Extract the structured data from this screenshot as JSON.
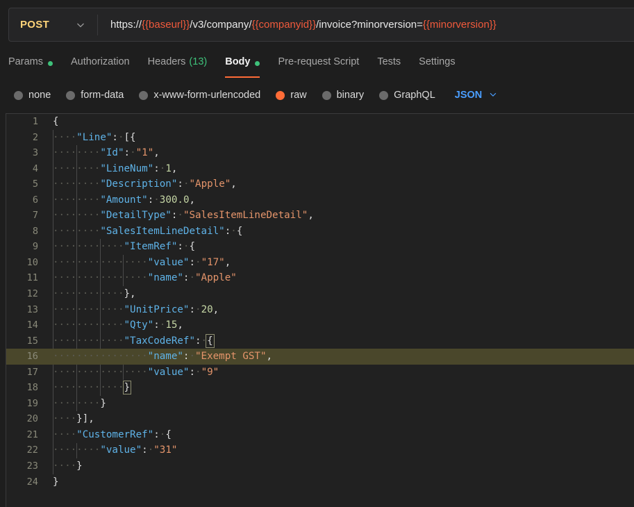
{
  "request": {
    "method": "POST",
    "method_icon": "chevron-down-icon",
    "url_parts": [
      {
        "t": "https://",
        "var": false
      },
      {
        "t": "{{baseurl}}",
        "var": true
      },
      {
        "t": "/v3/company/",
        "var": false
      },
      {
        "t": "{{companyid}}",
        "var": true
      },
      {
        "t": "/invoice?minorversion=",
        "var": false
      },
      {
        "t": "{{minorversion}}",
        "var": true
      }
    ],
    "url_plain": "https://{{baseurl}}/v3/company/{{companyid}}/invoice?minorversion={{minorversion}}"
  },
  "tabs": [
    {
      "label": "Params",
      "dot": true,
      "count": "",
      "active": false
    },
    {
      "label": "Authorization",
      "dot": false,
      "count": "",
      "active": false
    },
    {
      "label": "Headers",
      "dot": false,
      "count": "(13)",
      "active": false
    },
    {
      "label": "Body",
      "dot": true,
      "count": "",
      "active": true
    },
    {
      "label": "Pre-request Script",
      "dot": false,
      "count": "",
      "active": false
    },
    {
      "label": "Tests",
      "dot": false,
      "count": "",
      "active": false
    },
    {
      "label": "Settings",
      "dot": false,
      "count": "",
      "active": false
    }
  ],
  "body_types": [
    {
      "label": "none",
      "selected": false
    },
    {
      "label": "form-data",
      "selected": false
    },
    {
      "label": "x-www-form-urlencoded",
      "selected": false
    },
    {
      "label": "raw",
      "selected": true
    },
    {
      "label": "binary",
      "selected": false
    },
    {
      "label": "GraphQL",
      "selected": false
    }
  ],
  "format": {
    "label": "JSON",
    "icon": "chevron-down-icon"
  },
  "colors": {
    "accent": "#ff6c37",
    "method": "#ffd479",
    "variable": "#f05a3c",
    "dot": "#3ec17a",
    "format": "#4a9eff",
    "key": "#5fb3e8",
    "string": "#e5956b",
    "number": "#c5d6a5",
    "highlight_line": "#4a472b"
  },
  "editor": {
    "language": "json",
    "total_lines": 24,
    "active_line": 16,
    "raw_body": "{\n    \"Line\": [{\n        \"Id\": \"1\",\n        \"LineNum\": 1,\n        \"Description\": \"Apple\",\n        \"Amount\": 300.0,\n        \"DetailType\": \"SalesItemLineDetail\",\n        \"SalesItemLineDetail\": {\n            \"ItemRef\": {\n                \"value\": \"17\",\n                \"name\": \"Apple\"\n            },\n            \"UnitPrice\": 20,\n            \"Qty\": 15,\n            \"TaxCodeRef\": {\n                \"name\": \"Exempt GST\",\n                \"value\": \"9\"\n            }\n        }\n    }],\n    \"CustomerRef\": {\n        \"value\": \"31\"\n    }\n}",
    "lines": [
      {
        "no": 1,
        "indent": 0,
        "tokens": [
          {
            "c": "p",
            "t": "{"
          }
        ]
      },
      {
        "no": 2,
        "indent": 1,
        "tokens": [
          {
            "c": "k",
            "t": "\"Line\""
          },
          {
            "c": "p",
            "t": ":"
          },
          {
            "c": "ws",
            "t": "·"
          },
          {
            "c": "p",
            "t": "[{"
          }
        ]
      },
      {
        "no": 3,
        "indent": 2,
        "tokens": [
          {
            "c": "k",
            "t": "\"Id\""
          },
          {
            "c": "p",
            "t": ":"
          },
          {
            "c": "ws",
            "t": "·"
          },
          {
            "c": "s",
            "t": "\"1\""
          },
          {
            "c": "p",
            "t": ","
          }
        ]
      },
      {
        "no": 4,
        "indent": 2,
        "tokens": [
          {
            "c": "k",
            "t": "\"LineNum\""
          },
          {
            "c": "p",
            "t": ":"
          },
          {
            "c": "ws",
            "t": "·"
          },
          {
            "c": "n",
            "t": "1"
          },
          {
            "c": "p",
            "t": ","
          }
        ]
      },
      {
        "no": 5,
        "indent": 2,
        "tokens": [
          {
            "c": "k",
            "t": "\"Description\""
          },
          {
            "c": "p",
            "t": ":"
          },
          {
            "c": "ws",
            "t": "·"
          },
          {
            "c": "s",
            "t": "\"Apple\""
          },
          {
            "c": "p",
            "t": ","
          }
        ]
      },
      {
        "no": 6,
        "indent": 2,
        "tokens": [
          {
            "c": "k",
            "t": "\"Amount\""
          },
          {
            "c": "p",
            "t": ":"
          },
          {
            "c": "ws",
            "t": "·"
          },
          {
            "c": "n",
            "t": "300.0"
          },
          {
            "c": "p",
            "t": ","
          }
        ]
      },
      {
        "no": 7,
        "indent": 2,
        "tokens": [
          {
            "c": "k",
            "t": "\"DetailType\""
          },
          {
            "c": "p",
            "t": ":"
          },
          {
            "c": "ws",
            "t": "·"
          },
          {
            "c": "s",
            "t": "\"SalesItemLineDetail\""
          },
          {
            "c": "p",
            "t": ","
          }
        ]
      },
      {
        "no": 8,
        "indent": 2,
        "tokens": [
          {
            "c": "k",
            "t": "\"SalesItemLineDetail\""
          },
          {
            "c": "p",
            "t": ":"
          },
          {
            "c": "ws",
            "t": "·"
          },
          {
            "c": "p",
            "t": "{"
          }
        ]
      },
      {
        "no": 9,
        "indent": 3,
        "tokens": [
          {
            "c": "k",
            "t": "\"ItemRef\""
          },
          {
            "c": "p",
            "t": ":"
          },
          {
            "c": "ws",
            "t": "·"
          },
          {
            "c": "p",
            "t": "{"
          }
        ]
      },
      {
        "no": 10,
        "indent": 4,
        "tokens": [
          {
            "c": "k",
            "t": "\"value\""
          },
          {
            "c": "p",
            "t": ":"
          },
          {
            "c": "ws",
            "t": "·"
          },
          {
            "c": "s",
            "t": "\"17\""
          },
          {
            "c": "p",
            "t": ","
          }
        ]
      },
      {
        "no": 11,
        "indent": 4,
        "tokens": [
          {
            "c": "k",
            "t": "\"name\""
          },
          {
            "c": "p",
            "t": ":"
          },
          {
            "c": "ws",
            "t": "·"
          },
          {
            "c": "s",
            "t": "\"Apple\""
          }
        ]
      },
      {
        "no": 12,
        "indent": 3,
        "tokens": [
          {
            "c": "p",
            "t": "},"
          }
        ]
      },
      {
        "no": 13,
        "indent": 3,
        "tokens": [
          {
            "c": "k",
            "t": "\"UnitPrice\""
          },
          {
            "c": "p",
            "t": ":"
          },
          {
            "c": "ws",
            "t": "·"
          },
          {
            "c": "n",
            "t": "20"
          },
          {
            "c": "p",
            "t": ","
          }
        ]
      },
      {
        "no": 14,
        "indent": 3,
        "tokens": [
          {
            "c": "k",
            "t": "\"Qty\""
          },
          {
            "c": "p",
            "t": ":"
          },
          {
            "c": "ws",
            "t": "·"
          },
          {
            "c": "n",
            "t": "15"
          },
          {
            "c": "p",
            "t": ","
          }
        ]
      },
      {
        "no": 15,
        "indent": 3,
        "tokens": [
          {
            "c": "k",
            "t": "\"TaxCodeRef\""
          },
          {
            "c": "p",
            "t": ":"
          },
          {
            "c": "ws",
            "t": "·"
          },
          {
            "c": "p bm",
            "t": "{"
          }
        ]
      },
      {
        "no": 16,
        "indent": 4,
        "hl": true,
        "tokens": [
          {
            "c": "k",
            "t": "\"name\""
          },
          {
            "c": "p",
            "t": ":"
          },
          {
            "c": "ws",
            "t": "·"
          },
          {
            "c": "s",
            "t": "\"Exempt GST\""
          },
          {
            "c": "p",
            "t": ","
          }
        ]
      },
      {
        "no": 17,
        "indent": 4,
        "tokens": [
          {
            "c": "k",
            "t": "\"value\""
          },
          {
            "c": "p",
            "t": ":"
          },
          {
            "c": "ws",
            "t": "·"
          },
          {
            "c": "s",
            "t": "\"9\""
          }
        ]
      },
      {
        "no": 18,
        "indent": 3,
        "tokens": [
          {
            "c": "p bm",
            "t": "}"
          }
        ]
      },
      {
        "no": 19,
        "indent": 2,
        "tokens": [
          {
            "c": "p",
            "t": "}"
          }
        ]
      },
      {
        "no": 20,
        "indent": 1,
        "tokens": [
          {
            "c": "p",
            "t": "}],"
          }
        ]
      },
      {
        "no": 21,
        "indent": 1,
        "tokens": [
          {
            "c": "k",
            "t": "\"CustomerRef\""
          },
          {
            "c": "p",
            "t": ":"
          },
          {
            "c": "ws",
            "t": "·"
          },
          {
            "c": "p",
            "t": "{"
          }
        ]
      },
      {
        "no": 22,
        "indent": 2,
        "tokens": [
          {
            "c": "k",
            "t": "\"value\""
          },
          {
            "c": "p",
            "t": ":"
          },
          {
            "c": "ws",
            "t": "·"
          },
          {
            "c": "s",
            "t": "\"31\""
          }
        ]
      },
      {
        "no": 23,
        "indent": 1,
        "tokens": [
          {
            "c": "p",
            "t": "}"
          }
        ]
      },
      {
        "no": 24,
        "indent": 0,
        "tokens": [
          {
            "c": "p",
            "t": "}"
          }
        ]
      }
    ]
  }
}
